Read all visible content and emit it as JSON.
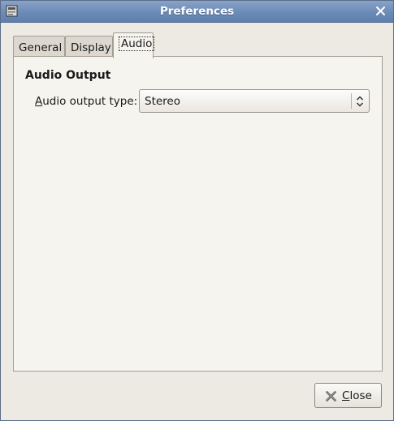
{
  "window": {
    "title": "Preferences"
  },
  "icons": {
    "app": "app-icon",
    "close_window": "close-icon",
    "close_button": "close-x-icon",
    "combo": "up-down-arrows-icon"
  },
  "tabs": [
    {
      "label": "General",
      "active": false
    },
    {
      "label": "Display",
      "active": false
    },
    {
      "label": "Audio",
      "active": true
    }
  ],
  "audio": {
    "section_title": "Audio Output",
    "output_label_mnemonic": "A",
    "output_label_rest": "udio output type:",
    "output_type_value": "Stereo"
  },
  "footer": {
    "close_mnemonic": "C",
    "close_rest": "lose"
  },
  "colors": {
    "titlebar": "#6b8bb7",
    "window_bg": "#ede9e3",
    "panel_bg": "#f6f4ef"
  }
}
